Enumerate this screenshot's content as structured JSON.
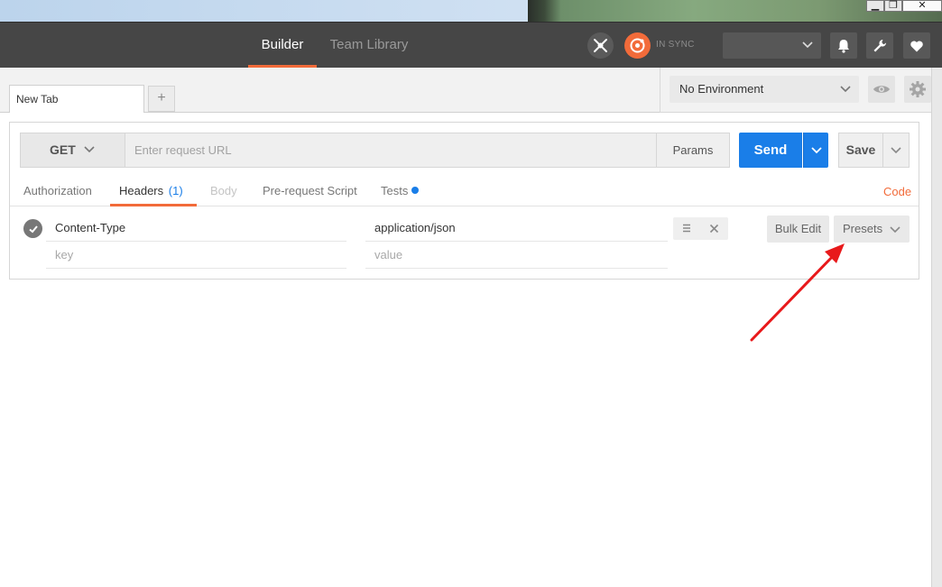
{
  "window": {
    "minimize_glyph": "▁",
    "maximize_glyph": "❐",
    "close_glyph": "✕"
  },
  "header": {
    "tabs": [
      {
        "label": "Builder",
        "active": true
      },
      {
        "label": "Team Library",
        "active": false
      }
    ],
    "sync_status": "IN SYNC",
    "icons": [
      "interceptor-icon",
      "sync-icon",
      "bell-icon",
      "wrench-icon",
      "heart-icon"
    ],
    "accent_color": "#f26b3a",
    "bar_color": "#464646"
  },
  "tabs": {
    "items": [
      {
        "label": "New Tab"
      }
    ],
    "add_label": "+"
  },
  "environment": {
    "selected": "No Environment"
  },
  "request": {
    "method": "GET",
    "url_placeholder": "Enter request URL",
    "url_value": "",
    "params_label": "Params",
    "send_label": "Send",
    "save_label": "Save",
    "send_color": "#1a7ee8"
  },
  "subtabs": {
    "authorization": "Authorization",
    "headers": "Headers",
    "headers_count": "(1)",
    "body": "Body",
    "prerequest": "Pre-request Script",
    "tests": "Tests",
    "code": "Code"
  },
  "headers": {
    "rows": [
      {
        "key": "Content-Type",
        "value": "application/json",
        "enabled": true
      }
    ],
    "key_placeholder": "key",
    "value_placeholder": "value",
    "bulk_edit_label": "Bulk Edit",
    "presets_label": "Presets"
  },
  "annotation": {
    "arrow_color": "#e8191b"
  }
}
